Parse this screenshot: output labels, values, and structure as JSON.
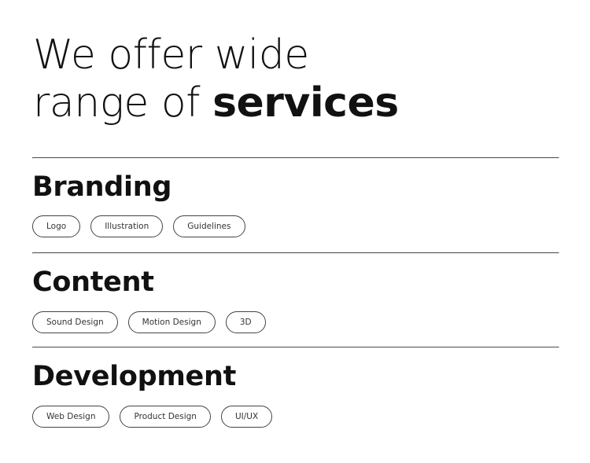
{
  "headline": {
    "line1": "We offer wide",
    "line2_light": "range of ",
    "line2_bold": "services"
  },
  "sections": [
    {
      "title": "Branding",
      "tags": [
        "Logo",
        "Illustration",
        "Guidelines"
      ]
    },
    {
      "title": "Content",
      "tags": [
        "Sound Design",
        "Motion Design",
        "3D"
      ]
    },
    {
      "title": "Development",
      "tags": [
        "Web Design",
        "Product Design",
        "UI/UX"
      ]
    }
  ]
}
